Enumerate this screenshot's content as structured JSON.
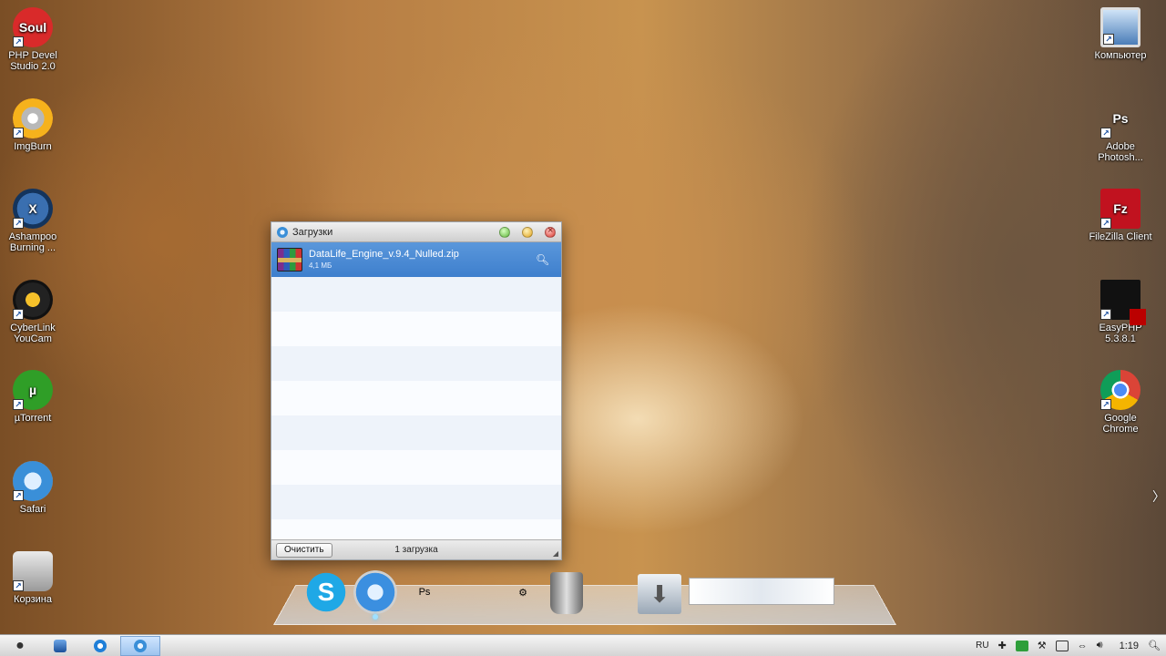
{
  "desktop": {
    "left_icons": [
      {
        "id": "php-devel",
        "label": "PHP Devel Studio 2.0",
        "glyph": "Soul",
        "icon": "php-devel-studio-icon"
      },
      {
        "id": "imgburn",
        "label": "ImgBurn",
        "glyph": "",
        "icon": "imgburn-icon"
      },
      {
        "id": "ashampoo",
        "label": "Ashampoo Burning ...",
        "glyph": "X",
        "icon": "ashampoo-icon"
      },
      {
        "id": "cyberlink",
        "label": "CyberLink YouCam",
        "glyph": "",
        "icon": "cyberlink-youcam-icon"
      },
      {
        "id": "utorrent",
        "label": "µTorrent",
        "glyph": "µ",
        "icon": "utorrent-icon"
      },
      {
        "id": "safari",
        "label": "Safari",
        "glyph": "",
        "icon": "safari-icon"
      },
      {
        "id": "recycle",
        "label": "Корзина",
        "glyph": "",
        "icon": "recycle-bin-icon"
      }
    ],
    "right_icons": [
      {
        "id": "computer",
        "label": "Компьютер",
        "glyph": "",
        "icon": "computer-icon"
      },
      {
        "id": "photoshop",
        "label": "Adobe Photosh...",
        "glyph": "Ps",
        "icon": "photoshop-icon"
      },
      {
        "id": "filezilla",
        "label": "FileZilla Client",
        "glyph": "Fz",
        "icon": "filezilla-icon"
      },
      {
        "id": "easyphp",
        "label": "EasyPHP 5.3.8.1",
        "glyph": "",
        "icon": "easyphp-icon"
      },
      {
        "id": "chrome",
        "label": "Google Chrome",
        "glyph": "",
        "icon": "chrome-icon"
      }
    ]
  },
  "downloads_window": {
    "title": "Загрузки",
    "items": [
      {
        "filename": "DataLife_Engine_v.9.4_Nulled.zip",
        "size": "4,1 МБ",
        "selected": true
      }
    ],
    "clear_button": "Очистить",
    "status": "1 загрузка"
  },
  "dock": {
    "items": [
      {
        "id": "skype",
        "glyph": "S",
        "icon": "skype-icon"
      },
      {
        "id": "safari",
        "glyph": "",
        "icon": "safari-icon"
      },
      {
        "id": "photoshop",
        "glyph": "Ps",
        "icon": "photoshop-icon"
      },
      {
        "id": "computer",
        "glyph": "",
        "icon": "monitor-icon"
      },
      {
        "id": "settings",
        "glyph": "⚙",
        "icon": "gear-icon"
      },
      {
        "id": "trash",
        "glyph": "",
        "icon": "trash-icon"
      },
      {
        "id": "apps",
        "glyph": "",
        "icon": "applications-folder-icon"
      },
      {
        "id": "downloads",
        "glyph": "⬇",
        "icon": "downloads-stack-icon"
      }
    ]
  },
  "taskbar": {
    "tray": {
      "lang": "RU",
      "clock": "1:19"
    }
  },
  "colors": {
    "selection": "#3e7fcd",
    "accent_green": "#2e9e3a"
  }
}
